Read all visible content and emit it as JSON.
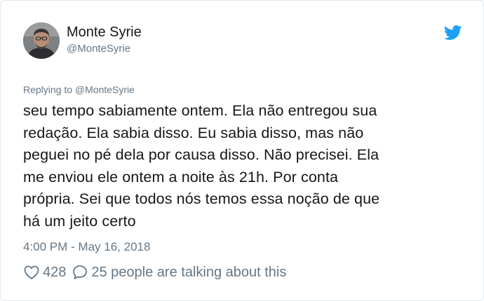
{
  "user": {
    "display_name": "Monte Syrie",
    "handle": "@MonteSyrie"
  },
  "tweet": {
    "replying_to": "Replying to @MonteSyrie",
    "lines": [
      "seu tempo sabiamente ontem. Ela não entregou sua",
      "redação. Ela sabia disso. Eu sabia disso, mas não",
      "peguei no pé dela por causa disso. Não precisei. Ela",
      "me enviou ele ontem a noite às 21h. Por conta",
      "própria. Sei que todos nós temos essa noção de que",
      "há um jeito certo"
    ],
    "timestamp": "4:00 PM - May 16, 2018"
  },
  "engagement": {
    "likes": "428",
    "talking": "25 people are talking about this"
  },
  "colors": {
    "twitter_blue": "#1da1f2",
    "secondary_text": "#657786",
    "primary_text": "#14171a",
    "border": "#e1e8ed"
  },
  "icons": {
    "avatar": "avatar",
    "brand": "twitter-bird-icon",
    "like": "heart-icon",
    "reply": "speech-bubble-icon"
  }
}
